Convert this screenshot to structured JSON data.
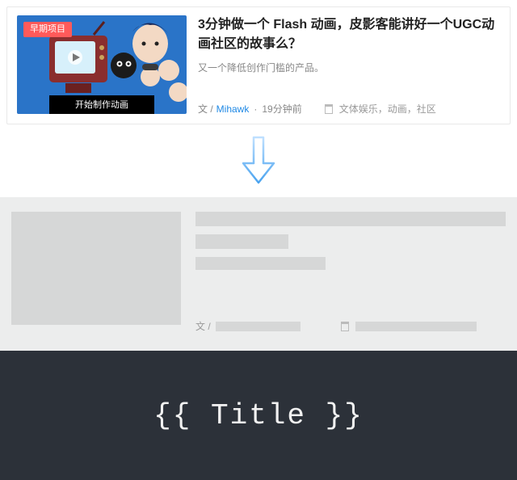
{
  "card": {
    "tag": "早期项目",
    "caption": "开始制作动画",
    "title": "3分钟做一个 Flash 动画，皮影客能讲好一个UGC动画社区的故事么？",
    "desc": "又一个降低创作门槛的产品。",
    "meta_prefix": "文 /",
    "author": "Mihawk",
    "time": "19分钟前",
    "categories": "文体娱乐，动画，社区"
  },
  "skeleton": {
    "meta_prefix": "文 /"
  },
  "template": {
    "expression": "{{ Title }}"
  }
}
